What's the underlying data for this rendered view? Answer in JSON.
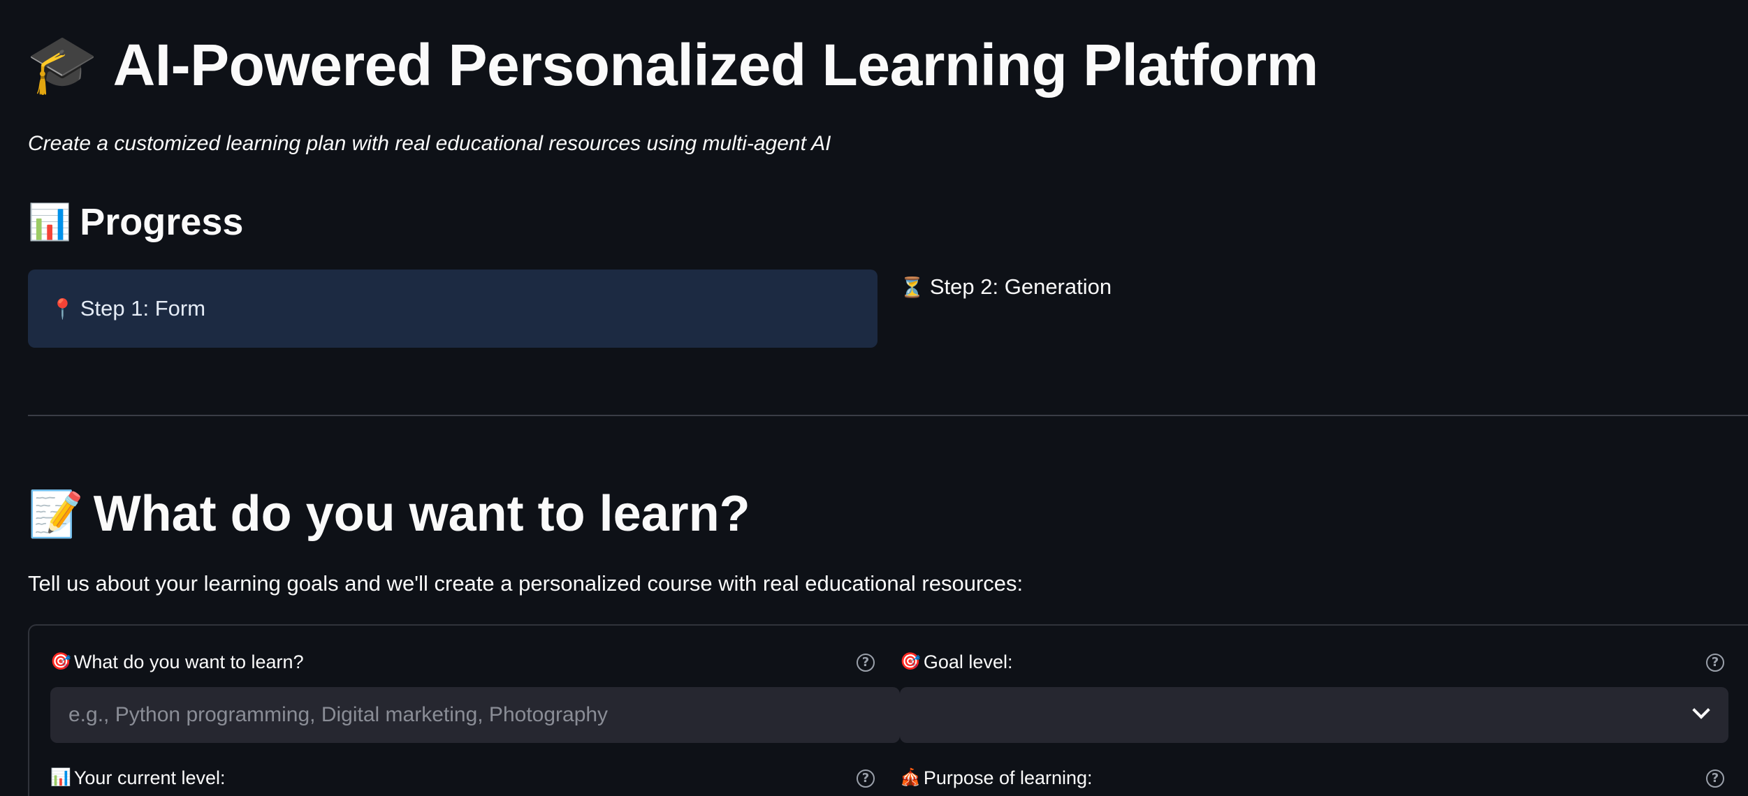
{
  "header": {
    "title_emoji": "🎓",
    "title": "AI-Powered Personalized Learning Platform",
    "subtitle": "Create a customized learning plan with real educational resources using multi-agent AI"
  },
  "progress": {
    "heading_emoji": "📊",
    "heading": "Progress",
    "steps": [
      {
        "emoji": "📍",
        "label": "Step 1: Form",
        "active": true
      },
      {
        "emoji": "⏳",
        "label": "Step 2: Generation",
        "active": false
      }
    ]
  },
  "form_section": {
    "heading_emoji": "📝",
    "heading": "What do you want to learn?",
    "intro": "Tell us about your learning goals and we'll create a personalized course with real educational resources:",
    "fields": {
      "topic": {
        "emoji": "🎯",
        "label": "What do you want to learn?",
        "placeholder": "e.g., Python programming, Digital marketing, Photography",
        "value": ""
      },
      "goal_level": {
        "emoji": "🎯",
        "label": "Goal level:",
        "value": ""
      },
      "current_level": {
        "emoji": "📊",
        "label": "Your current level:"
      },
      "purpose": {
        "emoji": "🎪",
        "label": "Purpose of learning:"
      }
    },
    "help_glyph": "?"
  }
}
